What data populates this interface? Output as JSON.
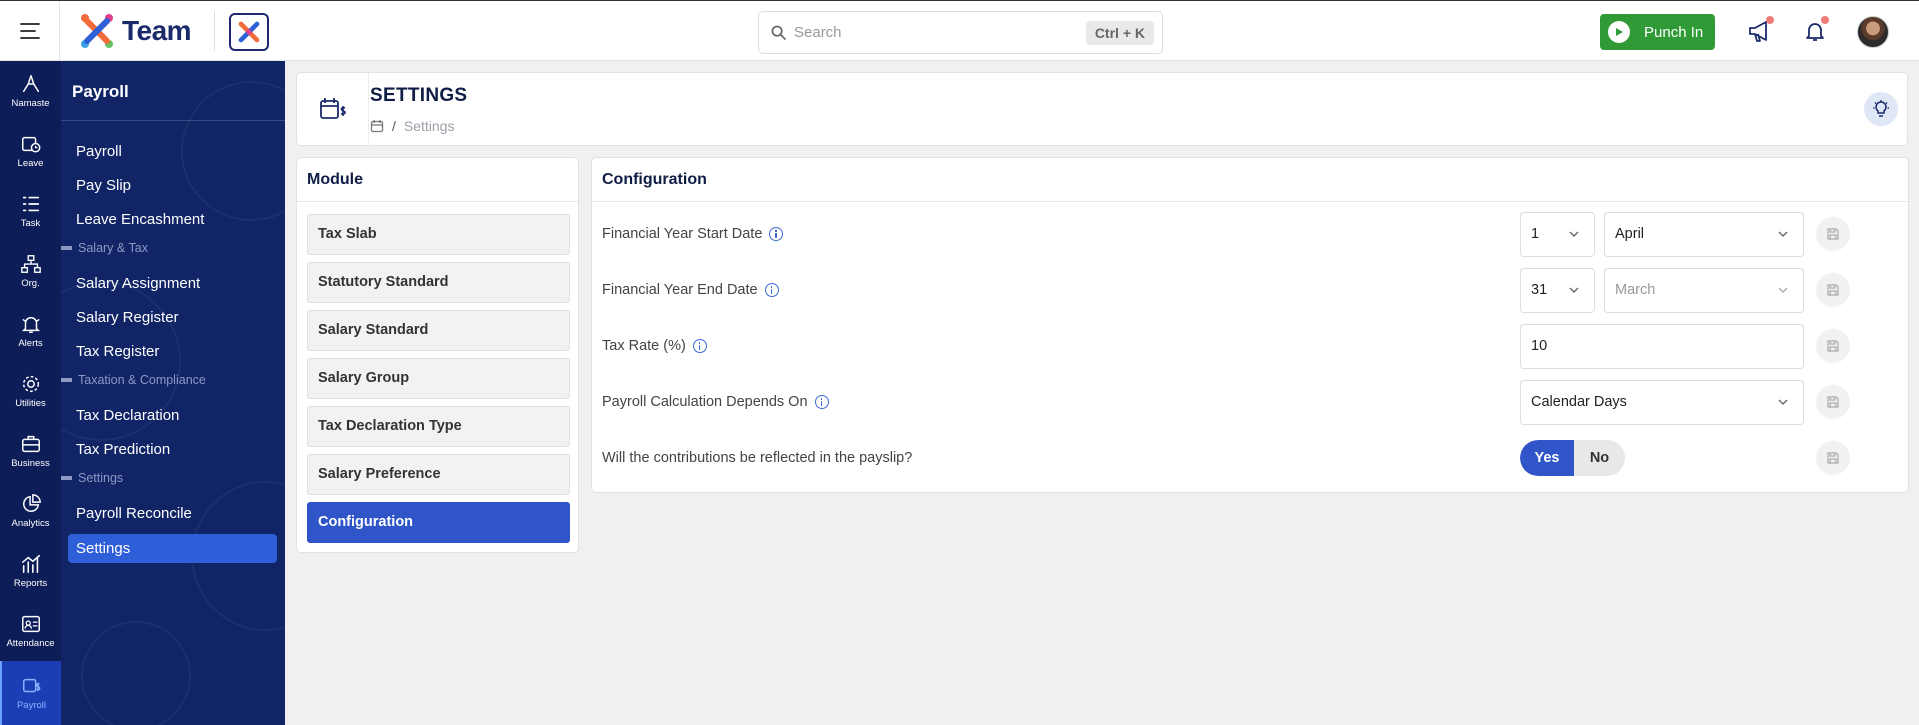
{
  "topbar": {
    "brand": "Team",
    "search_placeholder": "Search",
    "search_shortcut": "Ctrl + K",
    "punch_label": "Punch In"
  },
  "rail": [
    {
      "label": "Namaste",
      "icon": "namaste-icon"
    },
    {
      "label": "Leave",
      "icon": "calendar-clock-icon"
    },
    {
      "label": "Task",
      "icon": "task-list-icon"
    },
    {
      "label": "Org.",
      "icon": "org-chart-icon"
    },
    {
      "label": "Alerts",
      "icon": "bell-alert-icon"
    },
    {
      "label": "Utilities",
      "icon": "gear-icon"
    },
    {
      "label": "Business",
      "icon": "briefcase-icon"
    },
    {
      "label": "Analytics",
      "icon": "pie-chart-icon"
    },
    {
      "label": "Reports",
      "icon": "bar-chart-icon"
    },
    {
      "label": "Attendance",
      "icon": "attendance-icon"
    },
    {
      "label": "Payroll",
      "icon": "payroll-icon"
    }
  ],
  "subsidebar": {
    "title": "Payroll",
    "items": [
      {
        "label": "Payroll"
      },
      {
        "label": "Pay Slip"
      },
      {
        "label": "Leave Encashment"
      }
    ],
    "group_salary_tax": "Salary & Tax",
    "items2": [
      {
        "label": "Salary Assignment"
      },
      {
        "label": "Salary Register"
      },
      {
        "label": "Tax Register"
      }
    ],
    "group_taxation": "Taxation & Compliance",
    "items3": [
      {
        "label": "Tax Declaration"
      },
      {
        "label": "Tax Prediction"
      }
    ],
    "group_settings": "Settings",
    "items4": [
      {
        "label": "Payroll Reconcile"
      },
      {
        "label": "Settings"
      }
    ]
  },
  "header": {
    "title": "SETTINGS",
    "breadcrumb_sep": "/",
    "breadcrumb_current": "Settings"
  },
  "module": {
    "title": "Module",
    "items": [
      {
        "label": "Tax Slab"
      },
      {
        "label": "Statutory Standard"
      },
      {
        "label": "Salary Standard"
      },
      {
        "label": "Salary Group"
      },
      {
        "label": "Tax Declaration Type"
      },
      {
        "label": "Salary Preference"
      },
      {
        "label": "Configuration"
      }
    ]
  },
  "config": {
    "title": "Configuration",
    "fy_start_label": "Financial Year Start Date",
    "fy_start_day": "1",
    "fy_start_month": "April",
    "fy_end_label": "Financial Year End Date",
    "fy_end_day": "31",
    "fy_end_month": "March",
    "tax_rate_label": "Tax Rate (%)",
    "tax_rate_value": "10",
    "calc_label": "Payroll Calculation Depends On",
    "calc_value": "Calendar Days",
    "contrib_label": "Will the contributions be reflected in the payslip?",
    "yes_label": "Yes",
    "no_label": "No"
  },
  "colors": {
    "rail_bg": "#0d1d57",
    "sidebar_bg": "#102466",
    "accent": "#2f55c9",
    "punch_green": "#2f9a36"
  }
}
